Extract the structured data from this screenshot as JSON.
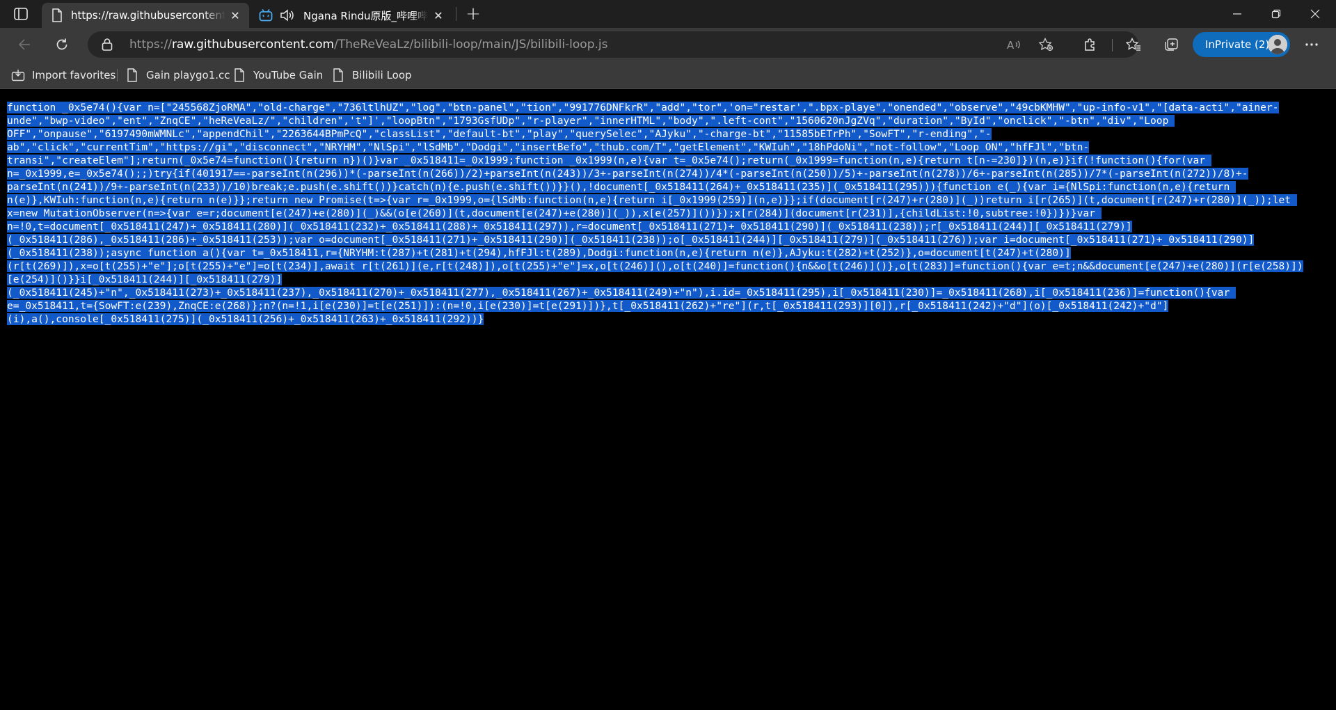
{
  "tabs": [
    {
      "title": "https://raw.githubusercontent.com/TheReVeaLz/bilibili-loop/main/JS/bilibili-loop.js",
      "active": true
    },
    {
      "title": "Ngana Rindu原版_哔哩哔哩_bilibili",
      "active": false
    }
  ],
  "address": {
    "proto": "https://",
    "host": "raw.githubusercontent.com",
    "path": "/TheReVeaLz/bilibili-loop/main/JS/bilibili-loop.js"
  },
  "profile": {
    "label": "InPrivate (2)"
  },
  "favorites": [
    {
      "label": "Import favorites",
      "icon": "import-favorites-icon"
    },
    {
      "label": "Gain playgo1.cc",
      "icon": "page-icon"
    },
    {
      "label": "YouTube Gain",
      "icon": "page-icon"
    },
    {
      "label": "Bilibili Loop",
      "icon": "page-icon"
    }
  ],
  "colors": {
    "selection": "#1259c9",
    "accent": "#0f6cbd",
    "chrome": "#3a3a3a",
    "tabstrip": "#1f1f1f"
  },
  "code_lines": [
    "function _0x5e74(){var n=[\"245568ZjoRMA\",\"old-charge\",\"736ltlhUZ\",\"log\",\"btn-panel\",\"tion\",\"991776DNFkrR\",\"add\",\"tor\",'on=\"restar',\".bpx-playe\",\"onended\",\"observe\",\"49cbKMHW\",\"up-info-v1\",\"[data-acti\",\"ainer-",
    "unde\",\"bwp-video\",\"ent\",\"ZnqCE\",\"heReVeaLz/\",\"children\",'t\"]',\"loopBtn\",\"1793GsfUDp\",\"r-player\",\"innerHTML\",\"body\",\".left-cont\",\"1560620nJgZVq\",\"duration\",\"ById\",\"onclick\",\"-btn\",\"div\",\"Loop ",
    "OFF\",\"onpause\",\"6197490mWMNLc\",\"appendChil\",\"2263644BPmPcQ\",\"classList\",\"default-bt\",\"play\",\"querySelec\",\"AJyku\",\"-charge-bt\",\"11585bETrPh\",\"SowFT\",\"r-ending\",\"-",
    "ab\",\"click\",\"currentTim\",\"https://gi\",\"disconnect\",\"NRYHM\",\"NlSpi\",\"lSdMb\",\"Dodgi\",\"insertBefo\",\"thub.com/T\",\"getElement\",\"KWIuh\",\"18hPdoNi\",\"not-follow\",\"Loop ON\",\"hfFJl\",\"btn-",
    "transi\",\"createElem\"];return(_0x5e74=function(){return n})()}var _0x518411=_0x1999;function _0x1999(n,e){var t=_0x5e74();return(_0x1999=function(n,e){return t[n-=230]})(n,e)}if(!function(){for(var ",
    "n=_0x1999,e=_0x5e74();;)try{if(401917==-parseInt(n(296))*(-parseInt(n(266))/2)+parseInt(n(243))/3+-parseInt(n(274))/4*(-parseInt(n(250))/5)+-parseInt(n(278))/6+-parseInt(n(285))/7*(-parseInt(n(272))/8)+-",
    "parseInt(n(241))/9+-parseInt(n(233))/10)break;e.push(e.shift())}catch(n){e.push(e.shift())}}(),!document[_0x518411(264)+_0x518411(235)](_0x518411(295))){function e(_){var i={NlSpi:function(n,e){return ",
    "n(e)},KWIuh:function(n,e){return n(e)}};return new Promise(t=>{var r=_0x1999,o={lSdMb:function(n,e){return i[_0x1999(259)](n,e)}};if(document[r(247)+r(280)](_))return i[r(265)](t,document[r(247)+r(280)](_));let ",
    "x=new MutationObserver(n=>{var e=r;document[e(247)+e(280)](_)&&(o[e(260)](t,document[e(247)+e(280)](_)),x[e(257)]())});x[r(284)](document[r(231)],{childList:!0,subtree:!0})})}var ",
    "n=!0,t=document[_0x518411(247)+_0x518411(280)](_0x518411(232)+_0x518411(288)+_0x518411(297)),r=document[_0x518411(271)+_0x518411(290)](_0x518411(238));r[_0x518411(244)][_0x518411(279)]",
    "(_0x518411(286),_0x518411(286)+_0x518411(253));var o=document[_0x518411(271)+_0x518411(290)](_0x518411(238));o[_0x518411(244)][_0x518411(279)](_0x518411(276));var i=document[_0x518411(271)+_0x518411(290)]",
    "(_0x518411(238));async function a(){var t=_0x518411,r={NRYHM:t(287)+t(281)+t(294),hfFJl:t(289),Dodgi:function(n,e){return n(e)},AJyku:t(282)+t(252)},o=document[t(247)+t(280)]",
    "(r[t(269)]),x=o[t(255)+\"e\"];o[t(255)+\"e\"]=o[t(234)],await r[t(261)](e,r[t(248)]),o[t(255)+\"e\"]=x,o[t(246)](),o[t(240)]=function(){n&&o[t(246)]()},o[t(283)]=function(){var e=t;n&&document[e(247)+e(280)](r[e(258)])",
    "[e(254)]()}}i[_0x518411(244)][_0x518411(279)]",
    "(_0x518411(245)+\"n\",_0x518411(273)+_0x518411(237),_0x518411(270)+_0x518411(277),_0x518411(267)+_0x518411(249)+\"n\"),i.id=_0x518411(295),i[_0x518411(230)]=_0x518411(268),i[_0x518411(236)]=function(){var ",
    "e=_0x518411,t={SowFT:e(239),ZnqCE:e(268)};n?(n=!1,i[e(230)]=t[e(251)]):(n=!0,i[e(230)]=t[e(291)])},t[_0x518411(262)+\"re\"](r,t[_0x518411(293)][0]),r[_0x518411(242)+\"d\"](o)[_0x518411(242)+\"d\"]",
    "(i),a(),console[_0x518411(275)](_0x518411(256)+_0x518411(263)+_0x518411(292))}"
  ]
}
